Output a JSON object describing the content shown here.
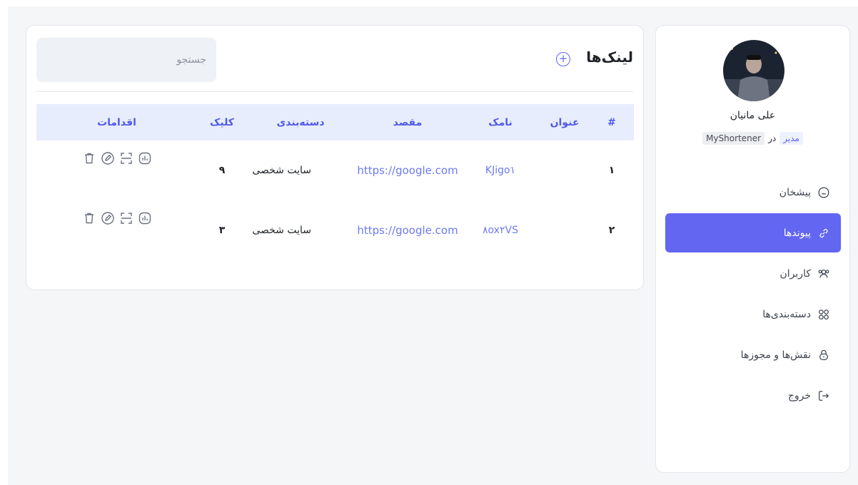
{
  "user": {
    "name": "علی مانیان",
    "role": "مدیر",
    "preposition": "در",
    "organization": "MyShortener"
  },
  "nav": {
    "items": [
      {
        "label": "پیشخان",
        "icon": "home-icon",
        "active": false
      },
      {
        "label": "پیوندها",
        "icon": "link-icon",
        "active": true
      },
      {
        "label": "کاربران",
        "icon": "users-icon",
        "active": false
      },
      {
        "label": "دسته‌بندی‌ها",
        "icon": "categories-icon",
        "active": false
      },
      {
        "label": "نقش‌ها و مجوزها",
        "icon": "lock-icon",
        "active": false
      },
      {
        "label": "خروج",
        "icon": "logout-icon",
        "active": false
      }
    ]
  },
  "main": {
    "title": "لینک‌ها",
    "add_icon": "plus-circle-icon",
    "search": {
      "placeholder": "جستجو",
      "value": ""
    },
    "table": {
      "headers": [
        "#",
        "عنوان",
        "نامک",
        "مقصد",
        "دسته‌بندی",
        "کلیک",
        "اقدامات"
      ],
      "rows": [
        {
          "num": "۱",
          "title": "",
          "slug": "KJigo۱",
          "destination": "https://google.com",
          "category": "سایت شخصی",
          "clicks": "۹"
        },
        {
          "num": "۲",
          "title": "",
          "slug": "۸ox۲VS",
          "destination": "https://google.com",
          "category": "سایت شخصی",
          "clicks": "۳"
        }
      ],
      "row_actions": [
        "stats-icon",
        "qr-icon",
        "edit-icon",
        "delete-icon"
      ]
    }
  },
  "colors": {
    "accent": "#6366f1",
    "header_bg": "#e8edfd",
    "link": "#6d7af0"
  }
}
